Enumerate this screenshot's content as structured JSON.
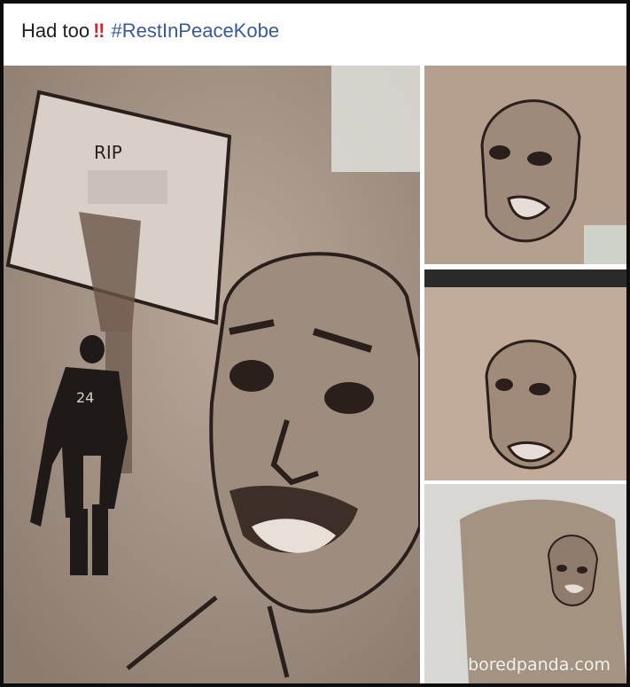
{
  "post": {
    "caption_text": "Had too",
    "caption_emoji": "‼",
    "hashtag": "#RestInPeaceKobe"
  },
  "photos": {
    "main": {
      "backboard_text": "RIP",
      "jersey_number": "24"
    },
    "watermark": "boredpanda.com"
  },
  "colors": {
    "hashtag": "#385898",
    "emoji": "#e0202a",
    "skin": "#a8978b",
    "ink": "#2a1f1a"
  }
}
